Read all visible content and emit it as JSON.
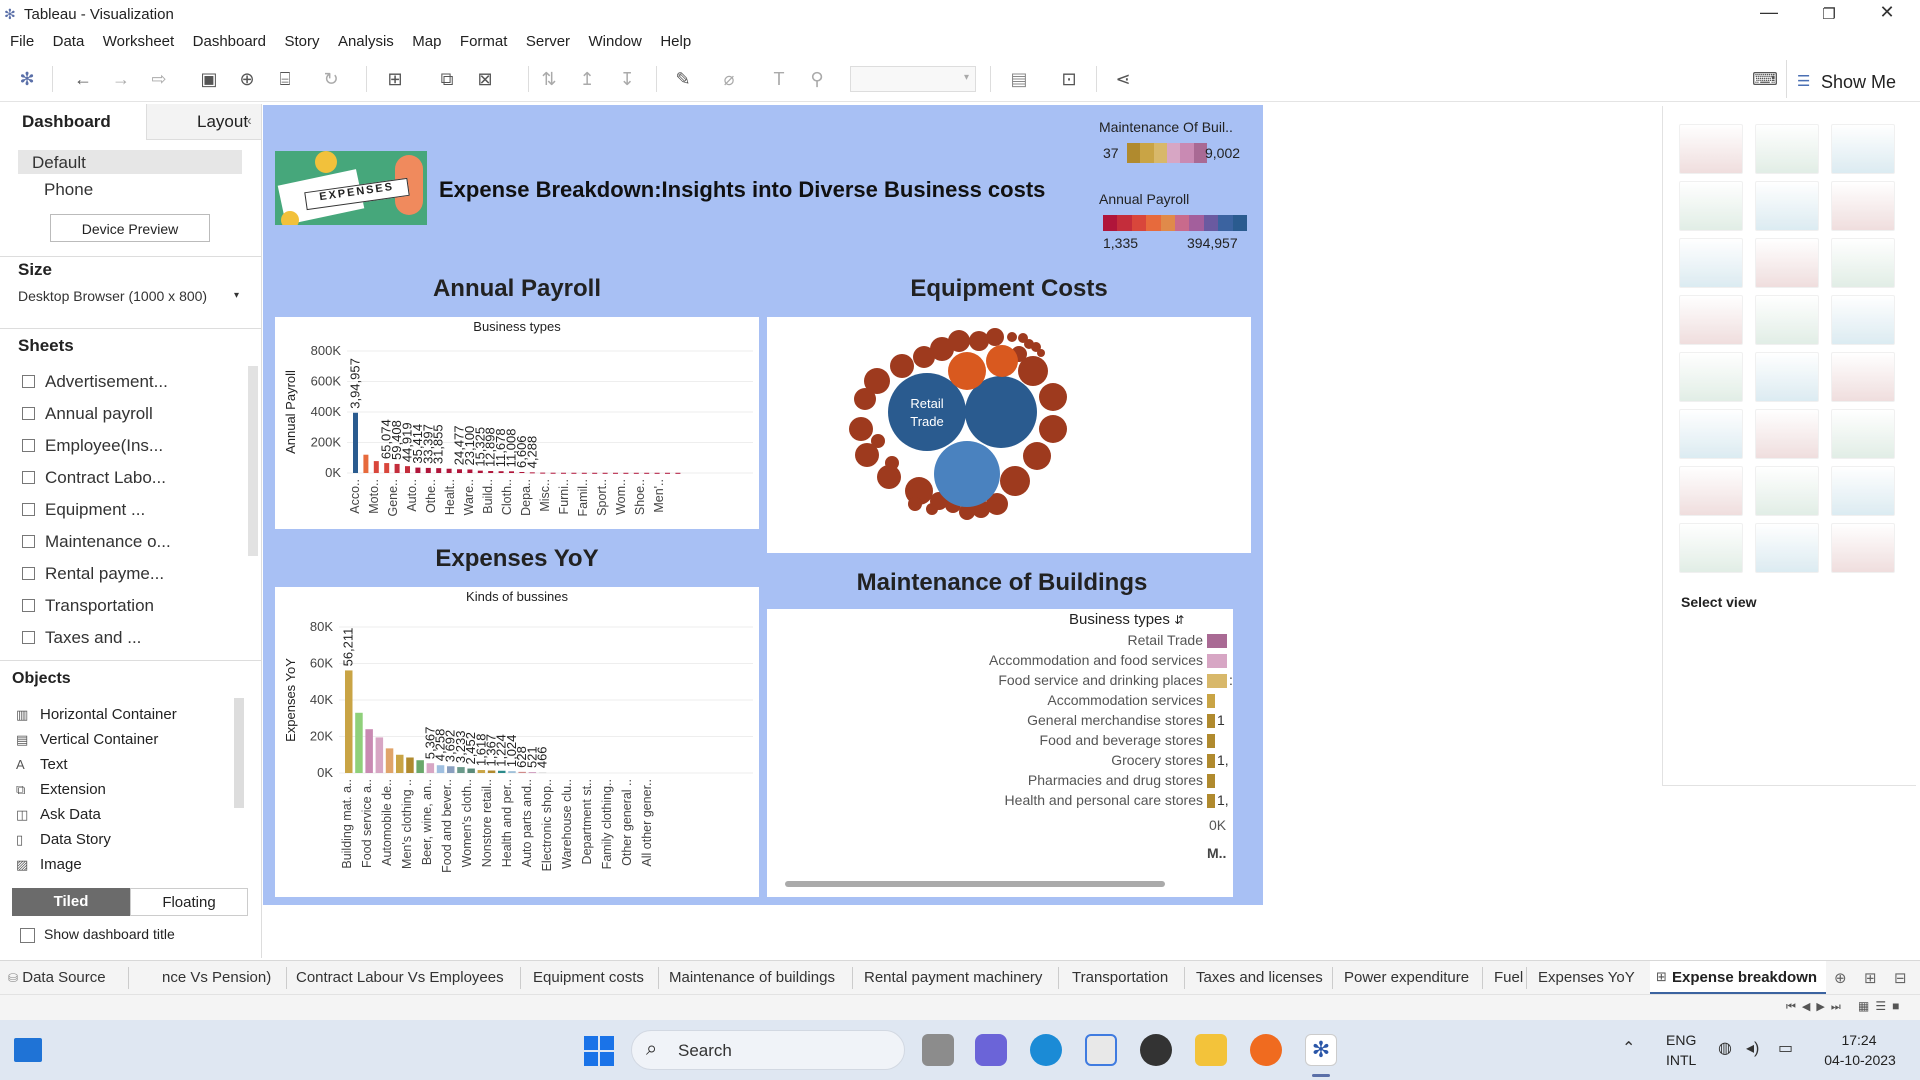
{
  "window": {
    "title": "Tableau - Visualization"
  },
  "menu": [
    "File",
    "Data",
    "Worksheet",
    "Dashboard",
    "Story",
    "Analysis",
    "Map",
    "Format",
    "Server",
    "Window",
    "Help"
  ],
  "toolbar": {
    "show_me": "Show Me"
  },
  "left_pane": {
    "tab_dashboard": "Dashboard",
    "tab_layout": "Layout",
    "device_default": "Default",
    "device_phone": "Phone",
    "device_preview": "Device Preview",
    "size_label": "Size",
    "size_value": "Desktop Browser (1000 x 800)",
    "sheets_label": "Sheets",
    "sheets": [
      "Advertisement...",
      "Annual payroll",
      "Employee(Ins...",
      "Contract Labo...",
      "Equipment ...",
      "Maintenance o...",
      "Rental payme...",
      "Transportation",
      "Taxes and ..."
    ],
    "objects_label": "Objects",
    "objects": [
      {
        "icon": "hcontainer",
        "label": "Horizontal Container"
      },
      {
        "icon": "vcontainer",
        "label": "Vertical Container"
      },
      {
        "icon": "text",
        "label": "Text"
      },
      {
        "icon": "extension",
        "label": "Extension"
      },
      {
        "icon": "askdata",
        "label": "Ask Data"
      },
      {
        "icon": "datastory",
        "label": "Data Story"
      },
      {
        "icon": "image",
        "label": "Image"
      }
    ],
    "tiled": "Tiled",
    "floating": "Floating",
    "show_title": "Show dashboard title"
  },
  "dashboard": {
    "header": "Expense Breakdown:Insights into Diverse Business costs",
    "image_text": "EXPENSES",
    "legend_maintenance": {
      "title": "Maintenance Of Buil..",
      "min": "37",
      "max": "9,002",
      "colors": [
        "#b08a2e",
        "#c9a445",
        "#d8b86a",
        "#d7a6c4",
        "#c98ab3",
        "#a96a94"
      ]
    },
    "legend_payroll": {
      "title": "Annual Payroll",
      "min": "1,335",
      "max": "394,957",
      "colors": [
        "#b0153a",
        "#c42d3b",
        "#d9463b",
        "#e76a3c",
        "#e08a4a",
        "#c96a8c",
        "#a35f9c",
        "#6a5aa0",
        "#3b63a0",
        "#2a5b8f"
      ]
    },
    "annual_payroll_title": "Annual Payroll",
    "equipment_title": "Equipment Costs",
    "expenses_title": "Expenses YoY",
    "maintenance_title": "Maintenance of Buildings",
    "bubble_label_1": "Retail",
    "bubble_label_2": "Trade",
    "maint_header": "Business types",
    "maint_axis_zero": "0K",
    "maint_axis_m": "M..",
    "maint_rows": [
      {
        "label": "Retail Trade",
        "value_text": "",
        "color": "#a96a94"
      },
      {
        "label": "Accommodation and food services",
        "value_text": "",
        "color": "#d7a6c4"
      },
      {
        "label": "Food service and drinking places",
        "value_text": ":",
        "color": "#d8b86a"
      },
      {
        "label": "Accommodation services",
        "value_text": "",
        "color": "#c9a445"
      },
      {
        "label": "General merchandise stores",
        "value_text": "1",
        "color": "#b08a2e"
      },
      {
        "label": "Food and beverage stores",
        "value_text": "",
        "color": "#b08a2e"
      },
      {
        "label": "Grocery stores",
        "value_text": "1,",
        "color": "#b08a2e"
      },
      {
        "label": "Pharmacies and drug stores",
        "value_text": "",
        "color": "#b08a2e"
      },
      {
        "label": "Health and personal care stores",
        "value_text": "1,",
        "color": "#b08a2e"
      }
    ]
  },
  "chart_data": [
    {
      "type": "bar",
      "title": "Business types",
      "ylabel": "Annual Payroll",
      "ylim": [
        0,
        800000
      ],
      "yticks": [
        "800K",
        "600K",
        "400K",
        "200K",
        "0K"
      ],
      "categories": [
        "Acco..",
        "Moto..",
        "Gene..",
        "Auto..",
        "Othe..",
        "Healt..",
        "Ware..",
        "Build..",
        "Cloth..",
        "Depa..",
        "Misc..",
        "Furni..",
        "Famil..",
        "Sport..",
        "Wom..",
        "Shoe..",
        "Men'.."
      ],
      "series": [
        {
          "values": [
            394957,
            120000,
            78000,
            65074,
            59408,
            44919,
            35414,
            33397,
            31855,
            28000,
            24477,
            23100,
            15325,
            12898,
            11678,
            11008,
            6606,
            4288,
            2500,
            1800,
            1600,
            1500,
            1450,
            1400,
            1380,
            1360,
            1350,
            1345,
            1340,
            1338,
            1336,
            1335
          ],
          "labels": [
            "3,94,957",
            "",
            "",
            "65,074",
            "59,408",
            "44,919",
            "35,414",
            "33,397",
            "31,855",
            "",
            "24,477",
            "23,100",
            "15,325",
            "12,898",
            "11,678",
            "11,008",
            "6,606",
            "4,288",
            "",
            "",
            "",
            "",
            "",
            "",
            "",
            "",
            "",
            "",
            "",
            "",
            "",
            ""
          ]
        }
      ]
    },
    {
      "type": "bubble",
      "title": "Equipment Costs"
    },
    {
      "type": "bar",
      "title": "Kinds of bussines",
      "ylabel": "Expenses YoY",
      "ylim": [
        0,
        80000
      ],
      "yticks": [
        "80K",
        "60K",
        "40K",
        "20K",
        "0K"
      ],
      "categories": [
        "Building mat. a..",
        "Food service a..",
        "Automobile de..",
        "Men's clothing ..",
        "Beer, wine, an..",
        "Food and bever..",
        "Women's cloth..",
        "Nonstore retail..",
        "Health and per..",
        "Auto parts and..",
        "Electronic shop..",
        "Warehouse clu..",
        "Department st..",
        "Family clothing..",
        "Other general ..",
        "All other gener.."
      ],
      "series": [
        {
          "values": [
            56211,
            33000,
            24000,
            19500,
            13500,
            10000,
            8500,
            7000,
            5367,
            4258,
            3692,
            3233,
            2452,
            1618,
            1367,
            1224,
            1024,
            628,
            521,
            466
          ],
          "labels": [
            "56,211",
            "",
            "",
            "",
            "",
            "",
            "",
            "",
            "5,367",
            "4,258",
            "3,692",
            "3,233",
            "2,452",
            "1,618",
            "1,367",
            "1,224",
            "1,024",
            "628",
            "521",
            "466"
          ]
        }
      ]
    }
  ],
  "show_me_pane": {
    "select_view": "Select view"
  },
  "sheet_tabs": {
    "data_source": "Data Source",
    "tabs": [
      "nce Vs Pension)",
      "Contract Labour Vs Employees",
      "Equipment costs",
      "Maintenance of buildings",
      "Rental payment machinery",
      "Transportation",
      "Taxes and licenses",
      "Power expenditure",
      "Fuel",
      "Expenses YoY"
    ],
    "active": "Expense breakdown"
  },
  "taskbar": {
    "search": "Search",
    "lang1": "ENG",
    "lang2": "INTL",
    "time": "17:24",
    "date": "04-10-2023"
  }
}
